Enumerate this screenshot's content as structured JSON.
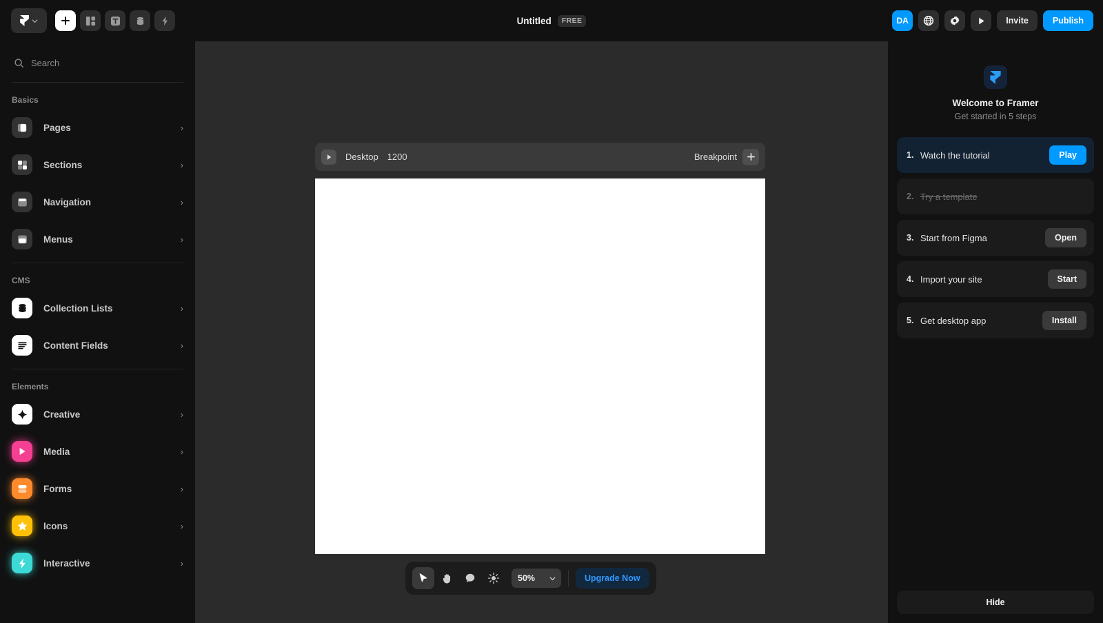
{
  "topbar": {
    "logo_icon": "framer-logo-icon",
    "logo_chevron_icon": "chevron-down-icon",
    "tools": [
      {
        "name": "insert",
        "icon": "plus-icon",
        "active": true
      },
      {
        "name": "layout",
        "icon": "layout-grid-icon",
        "active": false
      },
      {
        "name": "text",
        "icon": "text-t-icon",
        "active": false
      },
      {
        "name": "cms",
        "icon": "database-icon",
        "active": false
      },
      {
        "name": "interactive",
        "icon": "lightning-bolt-icon",
        "active": false
      }
    ],
    "title": "Untitled",
    "plan_badge": "FREE",
    "avatar_initials": "DA",
    "globe_icon": "globe-icon",
    "settings_icon": "gear-icon",
    "preview_icon": "play-icon",
    "invite_label": "Invite",
    "publish_label": "Publish"
  },
  "sidebar": {
    "search_placeholder": "Search",
    "search_icon": "search-icon",
    "groups": [
      {
        "label": "Basics",
        "items": [
          {
            "label": "Pages",
            "icon": "pages-icon",
            "icon_bg": "#333333",
            "glyph_color": "#ffffff",
            "chevron": "›"
          },
          {
            "label": "Sections",
            "icon": "sections-icon",
            "icon_bg": "#333333",
            "glyph_color": "#ffffff",
            "chevron": "›"
          },
          {
            "label": "Navigation",
            "icon": "navigation-icon",
            "icon_bg": "#333333",
            "glyph_color": "#ffffff",
            "chevron": "›"
          },
          {
            "label": "Menus",
            "icon": "menus-icon",
            "icon_bg": "#333333",
            "glyph_color": "#ffffff",
            "chevron": "›"
          }
        ]
      },
      {
        "label": "CMS",
        "items": [
          {
            "label": "Collection Lists",
            "icon": "database-icon",
            "icon_bg": "#ffffff",
            "glyph_color": "#111111",
            "chevron": "›"
          },
          {
            "label": "Content Fields",
            "icon": "text-lines-icon",
            "icon_bg": "#ffffff",
            "glyph_color": "#111111",
            "chevron": "›"
          }
        ]
      },
      {
        "label": "Elements",
        "items": [
          {
            "label": "Creative",
            "icon": "sparkle-icon",
            "icon_bg": "#ffffff",
            "glyph_color": "#111111",
            "chevron": "›"
          },
          {
            "label": "Media",
            "icon": "play-icon",
            "icon_bg": "#f53f93",
            "glyph_color": "#ffffff",
            "chevron": "›"
          },
          {
            "label": "Forms",
            "icon": "form-fields-icon",
            "icon_bg": "#ff8a2b",
            "glyph_color": "#ffffff",
            "chevron": "›"
          },
          {
            "label": "Icons",
            "icon": "star-icon",
            "icon_bg": "#ffc107",
            "glyph_color": "#ffffff",
            "chevron": "›"
          },
          {
            "label": "Interactive",
            "icon": "lightning-bolt-icon",
            "icon_bg": "#3dd9d6",
            "glyph_color": "#ffffff",
            "chevron": "›"
          }
        ]
      }
    ]
  },
  "canvas": {
    "breakpoint": {
      "play_icon": "play-icon",
      "name": "Desktop",
      "width": "1200",
      "add_label": "Breakpoint",
      "add_icon": "plus-icon"
    }
  },
  "bottom_toolbar": {
    "tools": [
      {
        "name": "select-tool",
        "icon": "cursor-arrow-icon",
        "selected": true
      },
      {
        "name": "hand-tool",
        "icon": "hand-icon",
        "selected": false
      },
      {
        "name": "comment-tool",
        "icon": "comment-icon",
        "selected": false
      },
      {
        "name": "brightness-tool",
        "icon": "sun-icon",
        "selected": false
      }
    ],
    "zoom_value": "50%",
    "zoom_chevron_icon": "chevron-down-icon",
    "upgrade_label": "Upgrade Now"
  },
  "right_panel": {
    "logo_icon": "framer-logo-icon",
    "title": "Welcome to Framer",
    "subtitle": "Get started in 5 steps",
    "steps": [
      {
        "num": "1.",
        "text": "Watch the tutorial",
        "button": "Play",
        "state": "highlight"
      },
      {
        "num": "2.",
        "text": "Try a template",
        "button": "",
        "state": "done"
      },
      {
        "num": "3.",
        "text": "Start from Figma",
        "button": "Open",
        "state": "normal"
      },
      {
        "num": "4.",
        "text": "Import your site",
        "button": "Start",
        "state": "normal"
      },
      {
        "num": "5.",
        "text": "Get desktop app",
        "button": "Install",
        "state": "normal"
      }
    ],
    "hide_label": "Hide"
  },
  "colors": {
    "accent_blue": "#0099ff",
    "panel_bg": "#111111",
    "canvas_bg": "#2b2b2b",
    "frame_bg": "#ffffff"
  }
}
